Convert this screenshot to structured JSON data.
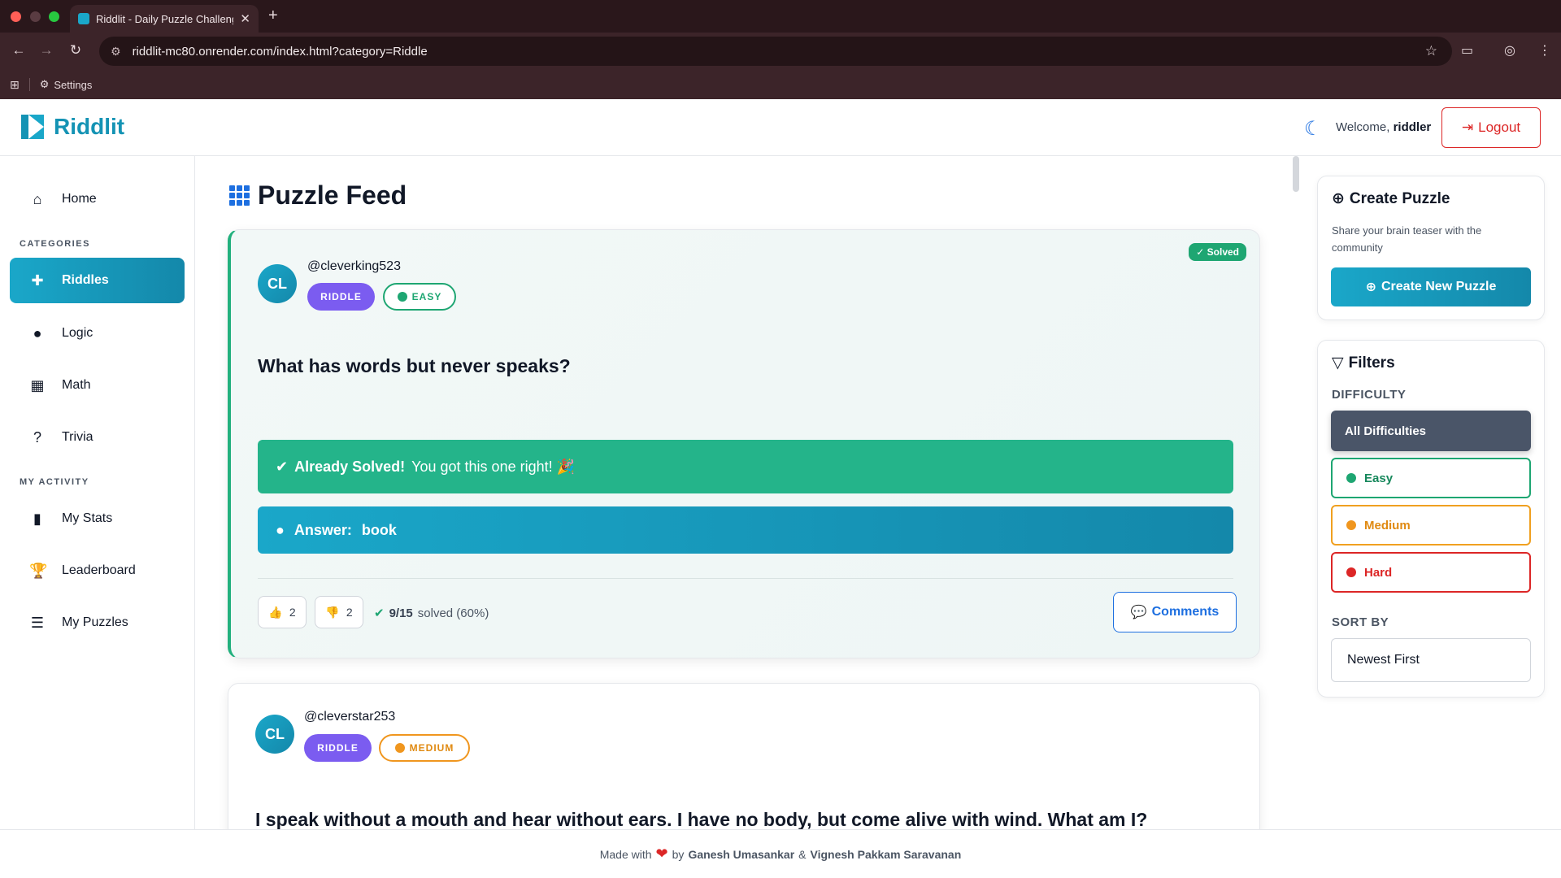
{
  "browser": {
    "tab_title": "Riddlit - Daily Puzzle Challenge",
    "url": "riddlit-mc80.onrender.com/index.html?category=Riddle",
    "bookmark_settings": "Settings"
  },
  "header": {
    "brand": "Riddlit",
    "welcome_prefix": "Welcome,",
    "username": "riddler",
    "logout_label": "Logout"
  },
  "sidebar": {
    "home": "Home",
    "categories_heading": "CATEGORIES",
    "categories": [
      "Riddles",
      "Logic",
      "Math",
      "Trivia"
    ],
    "activity_heading": "MY ACTIVITY",
    "activity": [
      "My Stats",
      "Leaderboard",
      "My Puzzles"
    ]
  },
  "main": {
    "title": "Puzzle Feed",
    "puzzles": [
      {
        "author": "@cleverking523",
        "initials": "CL",
        "category": "RIDDLE",
        "difficulty": "EASY",
        "solved_badge": "✓ Solved",
        "question": "What has words but never speaks?",
        "solved_bold": "Already Solved!",
        "solved_text": "You got this one right! 🎉",
        "answer_label": "Answer:",
        "answer": "book",
        "likes": "2",
        "dislikes": "2",
        "solved_count": "9/15",
        "solved_suffix": "solved (60%)",
        "comments_label": "Comments"
      },
      {
        "author": "@cleverstar253",
        "initials": "CL",
        "category": "RIDDLE",
        "difficulty": "MEDIUM",
        "question": "I speak without a mouth and hear without ears. I have no body, but come alive with wind. What am I?"
      }
    ]
  },
  "create_panel": {
    "title": "Create Puzzle",
    "description": "Share your brain teaser with the community",
    "button": "Create New Puzzle"
  },
  "filters": {
    "title": "Filters",
    "difficulty_label": "DIFFICULTY",
    "options": [
      "All Difficulties",
      "Easy",
      "Medium",
      "Hard"
    ],
    "sort_label": "SORT BY",
    "sort_value": "Newest First"
  },
  "footer": {
    "made_with": "Made with",
    "by": "by",
    "author1": "Ganesh Umasankar",
    "and": "&",
    "author2": "Vignesh Pakkam Saravanan"
  },
  "colors": {
    "accent": "#1aa7c9",
    "easy": "#1ea672",
    "medium": "#f0961e",
    "hard": "#dc2626",
    "riddle": "#7b5cf0"
  }
}
